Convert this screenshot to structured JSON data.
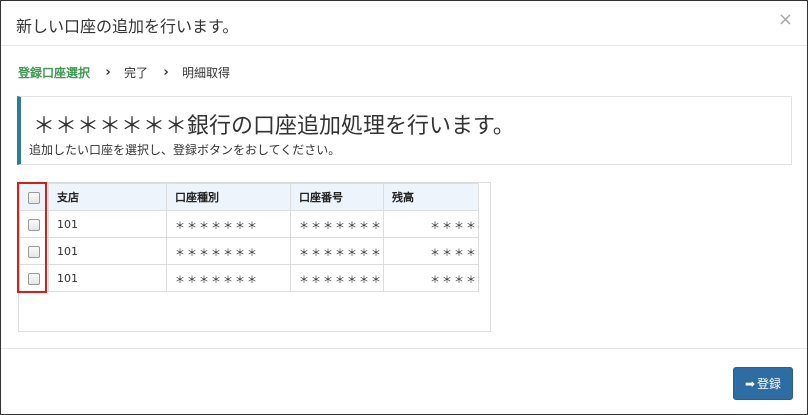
{
  "modal": {
    "title": "新しい口座の追加を行います。",
    "close_label": "×"
  },
  "stepper": {
    "steps": [
      {
        "label": "登録口座選択",
        "active": true
      },
      {
        "label": "完了",
        "active": false
      },
      {
        "label": "明細取得",
        "active": false
      }
    ],
    "separator": "›"
  },
  "notice": {
    "title": "＊＊＊＊＊＊＊銀行の口座追加処理を行います。",
    "subtitle": "追加したい口座を選択し、登録ボタンをおしてください。",
    "accent_color": "#2b7f8e"
  },
  "table": {
    "headers": [
      "支店",
      "口座種別",
      "口座番号",
      "残高"
    ],
    "rows": [
      {
        "branch": "101",
        "type": "＊＊＊＊＊＊＊",
        "number": "＊＊＊＊＊＊＊",
        "balance": "＊＊＊＊"
      },
      {
        "branch": "101",
        "type": "＊＊＊＊＊＊＊",
        "number": "＊＊＊＊＊＊＊",
        "balance": "＊＊＊＊"
      },
      {
        "branch": "101",
        "type": "＊＊＊＊＊＊＊",
        "number": "＊＊＊＊＊＊＊",
        "balance": "＊＊＊＊"
      }
    ],
    "highlight_color": "#d91e18"
  },
  "footer": {
    "register_label": "登録",
    "register_icon": "arrow-right-icon",
    "button_color": "#2e6da4"
  }
}
